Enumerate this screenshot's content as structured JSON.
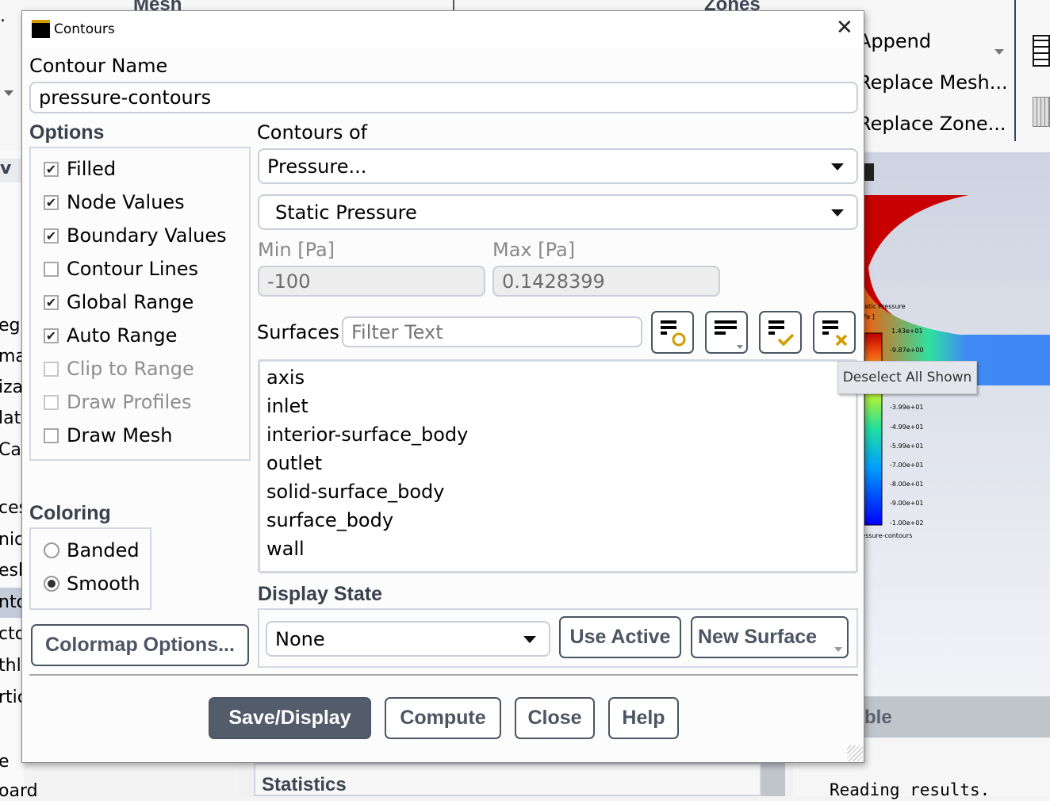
{
  "background": {
    "ribbon": {
      "mesh_label": "Mesh",
      "zones_label": "Zones",
      "append": "Append",
      "replace_mesh": "Replace Mesh...",
      "replace_zone": "Replace Zone..."
    },
    "sidebar_fragments": [
      "eg",
      "ma",
      "iza",
      "lat",
      "Calc",
      "ces",
      "nics",
      "esh",
      "nto",
      "cto",
      "thli",
      "rtic",
      "e",
      "oard"
    ],
    "statistics_label": "Statistics",
    "console_title_fragment": "ble",
    "console_text": "Reading results.",
    "graphics": {
      "legend_title": "Static Pressure",
      "legend_unit": "[ Pa ]",
      "legend_ticks": [
        "1.43e+01",
        "-9.87e+00",
        "-3.99e+01",
        "-4.99e+01",
        "-5.99e+01",
        "-7.00e+01",
        "-8.00e+01",
        "-9.00e+01",
        "-1.00e+02"
      ],
      "legend_caption": "pressure-contours",
      "colors": {
        "high": "#c80000",
        "low": "#0000ff",
        "flow": "#3f8af5",
        "background": "#d4d9e6"
      }
    }
  },
  "dialog": {
    "title": "Contours",
    "contour_name_label": "Contour Name",
    "contour_name_value": "pressure-contours",
    "options_label": "Options",
    "options": [
      {
        "label": "Filled",
        "checked": true,
        "enabled": true
      },
      {
        "label": "Node Values",
        "checked": true,
        "enabled": true
      },
      {
        "label": "Boundary Values",
        "checked": true,
        "enabled": true
      },
      {
        "label": "Contour Lines",
        "checked": false,
        "enabled": true
      },
      {
        "label": "Global Range",
        "checked": true,
        "enabled": true
      },
      {
        "label": "Auto Range",
        "checked": true,
        "enabled": true
      },
      {
        "label": "Clip to Range",
        "checked": false,
        "enabled": false
      },
      {
        "label": "Draw Profiles",
        "checked": false,
        "enabled": false
      },
      {
        "label": "Draw Mesh",
        "checked": false,
        "enabled": true
      }
    ],
    "contours_of_label": "Contours of",
    "contours_of_category": "Pressure...",
    "contours_of_variable": "Static Pressure",
    "min_label": "Min [Pa]",
    "min_value": "-100",
    "max_label": "Max [Pa]",
    "max_value": "0.1428399",
    "surfaces_label": "Surfaces",
    "filter_placeholder": "Filter Text",
    "surface_tools": [
      "select-shown-icon",
      "sort-list-icon",
      "select-all-shown-icon",
      "deselect-all-shown-icon"
    ],
    "tooltip": "Deselect All Shown",
    "surfaces": [
      "axis",
      "inlet",
      "interior-surface_body",
      "outlet",
      "solid-surface_body",
      "surface_body",
      "wall"
    ],
    "coloring_label": "Coloring",
    "coloring_options": [
      {
        "label": "Banded",
        "selected": false
      },
      {
        "label": "Smooth",
        "selected": true
      }
    ],
    "colormap_button": "Colormap Options...",
    "display_state_label": "Display State",
    "display_state_value": "None",
    "use_active_button": "Use Active",
    "new_surface_button": "New Surface",
    "buttons": {
      "save_display": "Save/Display",
      "compute": "Compute",
      "close": "Close",
      "help": "Help"
    },
    "accent_color": "#525c6a",
    "icon_accent_color": "#d39b00"
  }
}
